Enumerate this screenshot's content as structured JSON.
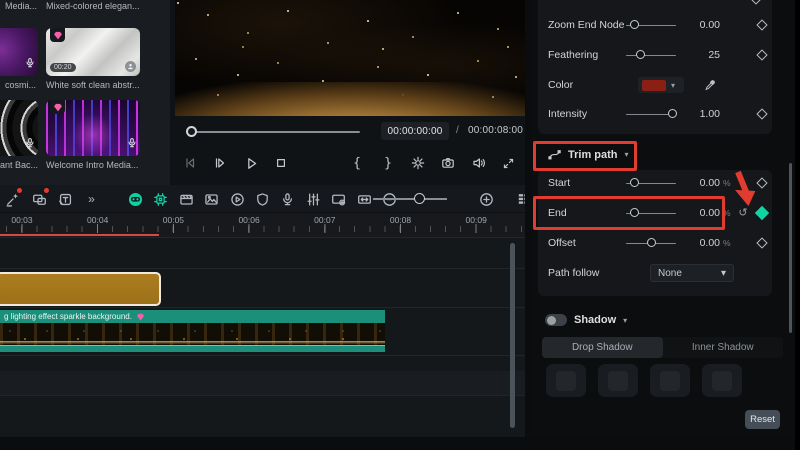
{
  "colors": {
    "accent_teal": "#14d0a4",
    "annotation_red": "#e23b30",
    "gold_clip": "#a1761f",
    "teal_clip": "#1b8f7a",
    "color_swatch": "#8c1f14"
  },
  "media_panel": {
    "top_labels": [
      "Media...",
      "Mixed-colored elegan..."
    ],
    "items": [
      {
        "label": "cosmi..."
      },
      {
        "label": "White soft clean abstr...",
        "duration": "00:20"
      },
      {
        "label": "ant Bac..."
      },
      {
        "label": "Welcome Intro Media..."
      }
    ]
  },
  "preview": {
    "current_time": "00:00:00:00",
    "separator": "/",
    "total_time": "00:00:08:00"
  },
  "toolbar": {
    "more_tools": "»"
  },
  "properties": {
    "group1": {
      "rows": [
        {
          "label": "Zoom End Node",
          "value": "0.00"
        },
        {
          "label": "Feathering",
          "value": "25"
        },
        {
          "label": "Color",
          "value": ""
        },
        {
          "label": "Intensity",
          "value": "1.00"
        }
      ]
    },
    "trim_path": {
      "title": "Trim path",
      "rows": [
        {
          "label": "Start",
          "value": "0.00",
          "unit": "%"
        },
        {
          "label": "End",
          "value": "0.00",
          "unit": "%"
        },
        {
          "label": "Offset",
          "value": "0.00",
          "unit": "%"
        }
      ],
      "path_follow": {
        "label": "Path follow",
        "value": "None"
      }
    },
    "shadow": {
      "title": "Shadow",
      "tabs": [
        "Drop Shadow",
        "Inner Shadow"
      ],
      "reset_label": "Reset"
    }
  },
  "timeline": {
    "ruler_labels": [
      "00:03",
      "00:04",
      "00:05",
      "00:06",
      "00:07",
      "00:08",
      "00:09"
    ],
    "sparkle_clip_label": "g lighting effect sparkle background."
  }
}
